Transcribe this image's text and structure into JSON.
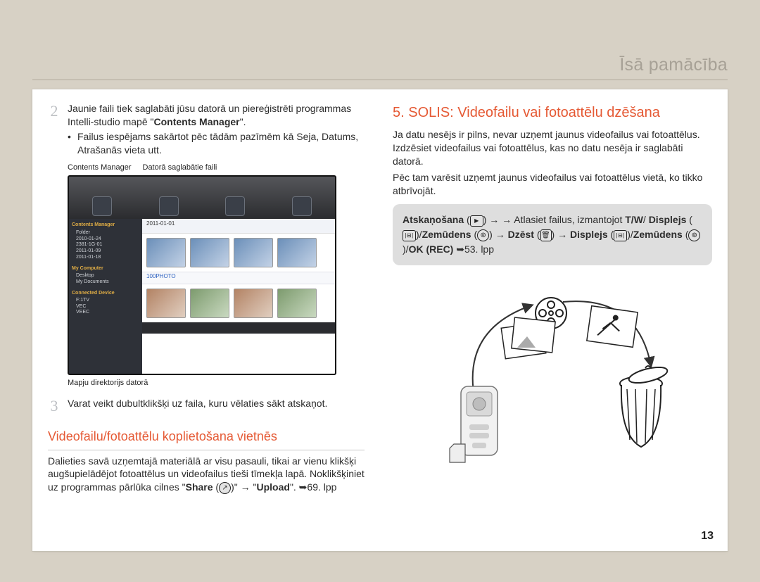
{
  "header": {
    "title": "Īsā pamācība"
  },
  "left": {
    "step2_num": "2",
    "step2_para": "Jaunie faili tiek saglabāti jūsu datorā un piereģistrēti programmas Intelli-studio mapē \"",
    "step2_bold": "Contents Manager",
    "step2_close": "\".",
    "step2_bullet": "Failus iespējams sakārtot pēc tādām pazīmēm kā Seja, Datums, Atrašanās vieta utt.",
    "fig_label_left": "Contents Manager",
    "fig_label_right": "Datorā saglabātie faili",
    "screenshot": {
      "side_block1_title": "Contents Manager",
      "side_block1_items": [
        "Folder",
        "2010-01-24",
        "2381-1G-01",
        "2011-01-09",
        "2011-01-18"
      ],
      "side_block2_title": "My Computer",
      "side_block2_items": [
        "Desktop",
        "My Documents"
      ],
      "side_block3_title": "Connected Device",
      "side_block3_items": [
        "F:1TV",
        "VEC",
        "VEEC"
      ],
      "main_hdr": "2011-01-01",
      "sub_hdr": "100PHOTO"
    },
    "cap_under": "Mapju direktorijs datorā",
    "step3_num": "3",
    "step3_text": "Varat veikt dubultklikšķi uz faila, kuru vēlaties sākt atskaņot.",
    "sub_heading": "Videofailu/fotoattēlu koplietošana vietnēs",
    "share_p1": "Dalieties savā uzņemtajā materiālā ar visu pasauli, tikai ar vienu klikšķi augšupielādējot fotoattēlus un videofailus tieši tīmekļa lapā. Noklikšķiniet uz programmas pārlūka cilnes \"",
    "share_bold1": "Share",
    "share_mid": " (",
    "share_close": ")\" → \"",
    "share_bold2": "Upload",
    "share_tail": "\". ➥69. lpp"
  },
  "right": {
    "step_heading": "5. SOLIS: Videofailu vai fotoattēlu dzēšana",
    "p1": "Ja datu nesējs ir pilns, nevar uzņemt jaunus videofailus vai fotoattēlus. Izdzēsiet videofailus vai fotoattēlus, kas no datu nesēja ir saglabāti datorā.",
    "p2": "Pēc tam varēsit uzņemt jaunus videofailus vai fotoattēlus vietā, ko tikko atbrīvojāt.",
    "info": {
      "w1": "Atskaņošana",
      "t1": "→ Atlasiet failus, izmantojot",
      "w2": "T/W",
      "slash": "/",
      "w3": "Displejs",
      "w4": "Zemūdens",
      "w5": "Dzēst",
      "w6": "Displejs",
      "w7": "Zemūdens",
      "w8": "OK (REC)",
      "tail": "➥53. lpp"
    }
  },
  "page_num": "13"
}
